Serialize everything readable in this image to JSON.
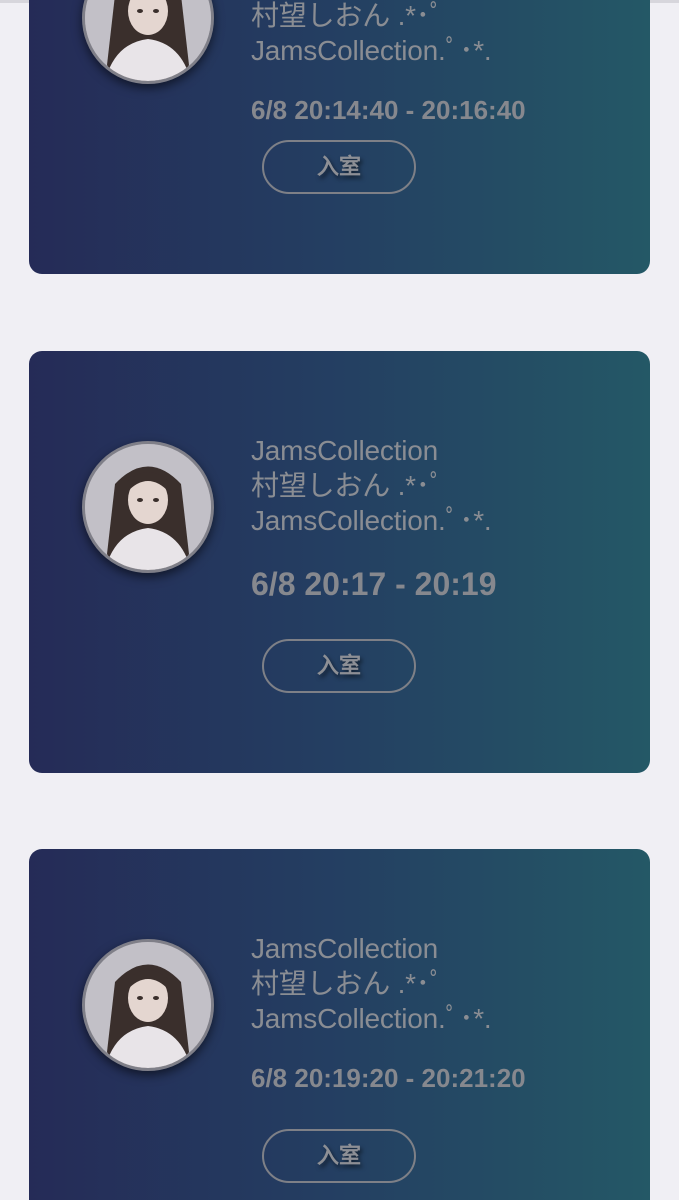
{
  "cards": [
    {
      "lines": [
        "村望しおん .*･ﾟ",
        "JamsCollection.ﾟ･*."
      ],
      "time": "6/8 20:14:40 - 20:16:40",
      "button_label": "入室"
    },
    {
      "lines": [
        "JamsCollection",
        "村望しおん .*･ﾟ",
        "JamsCollection.ﾟ･*."
      ],
      "time": "6/8 20:17 - 20:19",
      "button_label": "入室"
    },
    {
      "lines": [
        "JamsCollection",
        "村望しおん .*･ﾟ",
        "JamsCollection.ﾟ･*."
      ],
      "time": "6/8 20:19:20 - 20:21:20",
      "button_label": "入室"
    }
  ],
  "colors": {
    "page_bg": "#f0eff4",
    "card_gradient_start": "#252b57",
    "card_gradient_end": "#245866",
    "text": "#8a8d93"
  }
}
